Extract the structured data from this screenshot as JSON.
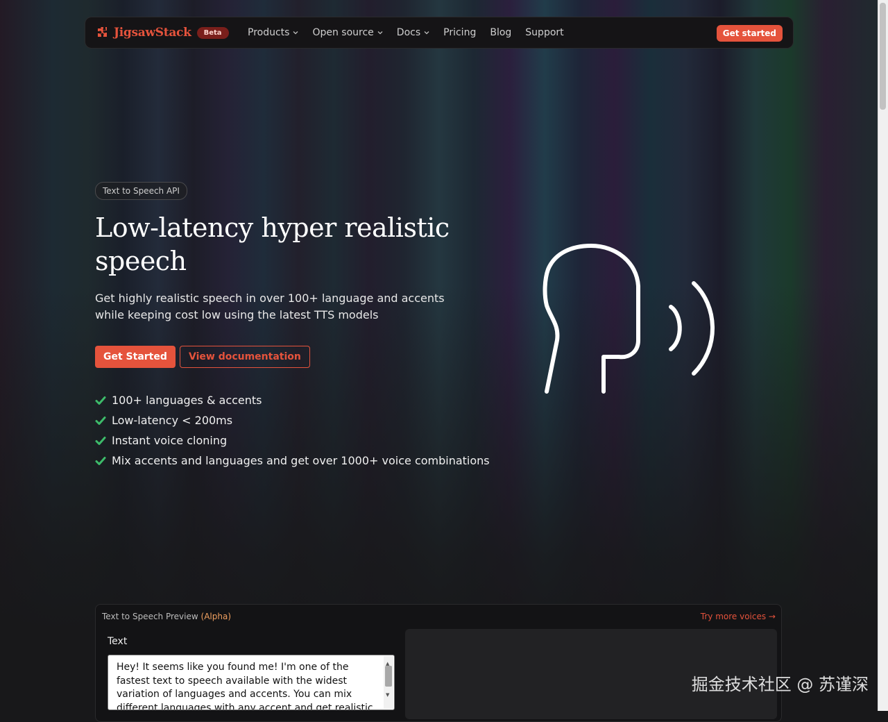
{
  "nav": {
    "brand": "JigsawStack",
    "badge": "Beta",
    "items": [
      {
        "label": "Products",
        "dropdown": true
      },
      {
        "label": "Open source",
        "dropdown": true
      },
      {
        "label": "Docs",
        "dropdown": true
      },
      {
        "label": "Pricing",
        "dropdown": false
      },
      {
        "label": "Blog",
        "dropdown": false
      },
      {
        "label": "Support",
        "dropdown": false
      }
    ],
    "cta": "Get started"
  },
  "hero": {
    "pill": "Text to Speech API",
    "headline": "Low-latency hyper realistic speech",
    "subtitle": "Get highly realistic speech in over 100+ language and accents while keeping cost low using the latest TTS models",
    "primary_button": "Get Started",
    "secondary_button": "View documentation",
    "features": [
      "100+ languages & accents",
      "Low-latency < 200ms",
      "Instant voice cloning",
      "Mix accents and languages and get over 1000+ voice combinations"
    ]
  },
  "preview": {
    "title": "Text to Speech Preview",
    "title_tag": "(Alpha)",
    "link": "Try more voices →",
    "text_label": "Text",
    "text_value": "Hey! It seems like you found me! I'm one of the fastest text to speech available with the widest variation of languages and accents. You can mix different languages with any accent and get realistic sounding voices. I'm"
  },
  "watermark": "掘金技术社区 @ 苏谨深",
  "colors": {
    "accent": "#e5533c",
    "check": "#3dbb6a",
    "background": "#18181a"
  },
  "icons": [
    "puzzle-logo-icon",
    "chevron-down-icon",
    "check-icon",
    "speaking-head-icon"
  ]
}
